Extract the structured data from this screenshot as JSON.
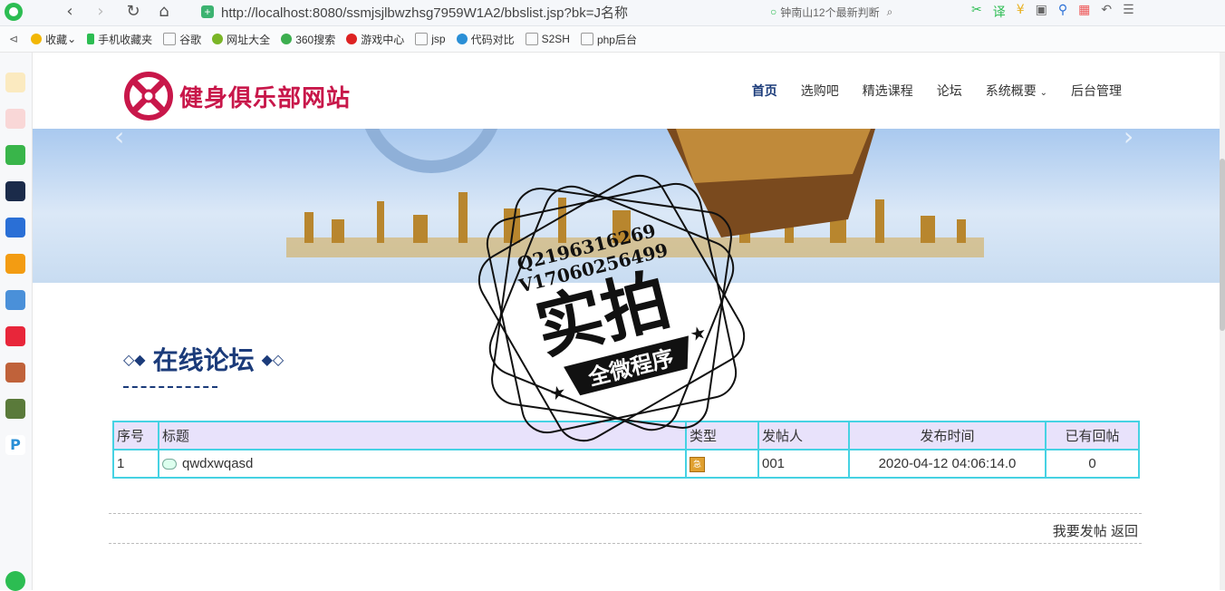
{
  "browser": {
    "url": "http://localhost:8080/ssmjsjlbwzhsg7959W1A2/bbslist.jsp?bk=J名称",
    "search_text": "钟南山12个最新判断",
    "bookmarks": [
      "收藏",
      "手机收藏夹",
      "谷歌",
      "网址大全",
      "360搜索",
      "游戏中心",
      "jsp",
      "代码对比",
      "S2SH",
      "php后台"
    ]
  },
  "site": {
    "logo_text": "健身俱乐部网站",
    "nav": [
      "首页",
      "选购吧",
      "精选课程",
      "论坛",
      "系统概要",
      "后台管理"
    ]
  },
  "forum": {
    "title": "在线论坛",
    "columns": [
      "序号",
      "标题",
      "类型",
      "发帖人",
      "发布时间",
      "已有回帖"
    ],
    "rows": [
      {
        "no": "1",
        "title": "qwdxwqasd",
        "type": "急",
        "author": "001",
        "time": "2020-04-12 04:06:14.0",
        "replies": "0"
      }
    ]
  },
  "actions": {
    "post": "我要发帖",
    "back": "返回"
  },
  "watermark": {
    "line1": "Q2196316269",
    "line2": "V17060256499",
    "big": "实拍",
    "ribbon": "全微程序"
  }
}
